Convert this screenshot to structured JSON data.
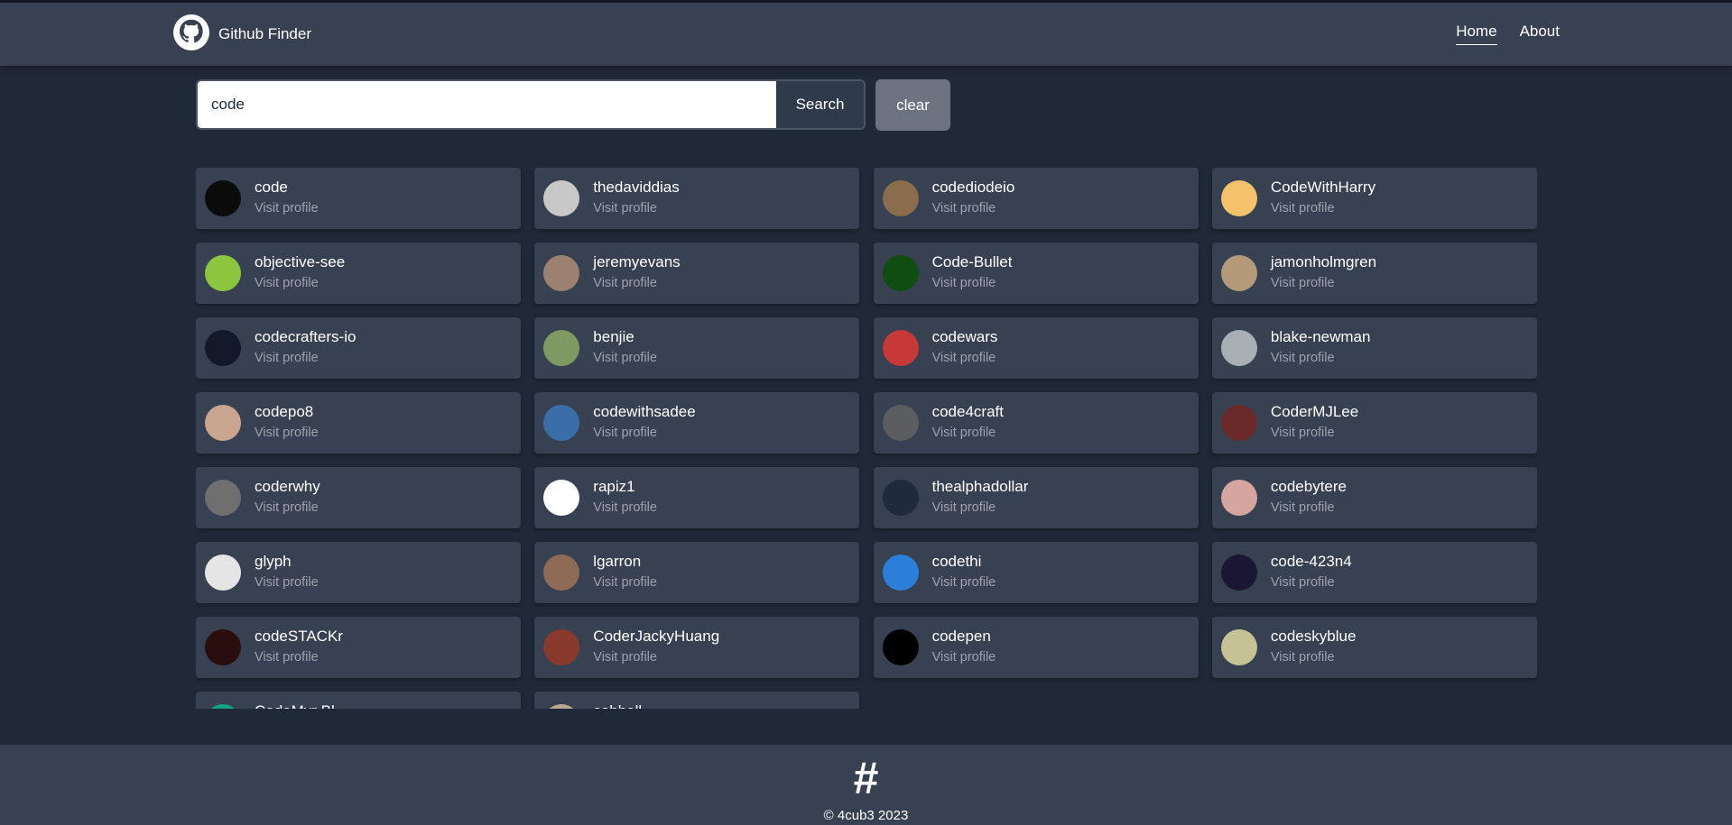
{
  "app": {
    "title": "Github Finder"
  },
  "nav": {
    "links": [
      {
        "label": "Home"
      },
      {
        "label": "About"
      }
    ]
  },
  "search": {
    "value": "code",
    "button_label": "Search",
    "clear_label": "clear"
  },
  "results": {
    "visit_label": "Visit profile",
    "users": [
      {
        "login": "code",
        "color": "#0b0b0b"
      },
      {
        "login": "thedaviddias",
        "color": "#c8c8c8"
      },
      {
        "login": "codediodeio",
        "color": "#8a6d4d"
      },
      {
        "login": "CodeWithHarry",
        "color": "#f4c26b"
      },
      {
        "login": "objective-see",
        "color": "#8cc63f"
      },
      {
        "login": "jeremyevans",
        "color": "#9c8170"
      },
      {
        "login": "Code-Bullet",
        "color": "#0f4d12"
      },
      {
        "login": "jamonholmgren",
        "color": "#b59a7a"
      },
      {
        "login": "codecrafters-io",
        "color": "#111827"
      },
      {
        "login": "benjie",
        "color": "#7e9a62"
      },
      {
        "login": "codewars",
        "color": "#c73838"
      },
      {
        "login": "blake-newman",
        "color": "#a8b0b3"
      },
      {
        "login": "codepo8",
        "color": "#c9a590"
      },
      {
        "login": "codewithsadee",
        "color": "#3b6ea8"
      },
      {
        "login": "code4craft",
        "color": "#5b5d5e"
      },
      {
        "login": "CoderMJLee",
        "color": "#6b2a2a"
      },
      {
        "login": "coderwhy",
        "color": "#6f6f6f"
      },
      {
        "login": "rapiz1",
        "color": "#ffffff"
      },
      {
        "login": "thealphadollar",
        "color": "#1f2b3a"
      },
      {
        "login": "codebytere",
        "color": "#d6a5a0"
      },
      {
        "login": "glyph",
        "color": "#e5e5e5"
      },
      {
        "login": "lgarron",
        "color": "#8e6a57"
      },
      {
        "login": "codethi",
        "color": "#2b7fd8"
      },
      {
        "login": "code-423n4",
        "color": "#1b1633"
      },
      {
        "login": "codeSTACKr",
        "color": "#2a0d0d"
      },
      {
        "login": "CoderJackyHuang",
        "color": "#8a3a2c"
      },
      {
        "login": "codepen",
        "color": "#000000"
      },
      {
        "login": "codeskyblue",
        "color": "#c6c296"
      },
      {
        "login": "CodeMyr Bl",
        "color": "#14a37f"
      },
      {
        "login": "cobbell",
        "color": "#b9a88d"
      }
    ]
  },
  "footer": {
    "logo": "#",
    "copyright": "© 4cub3 2023"
  }
}
